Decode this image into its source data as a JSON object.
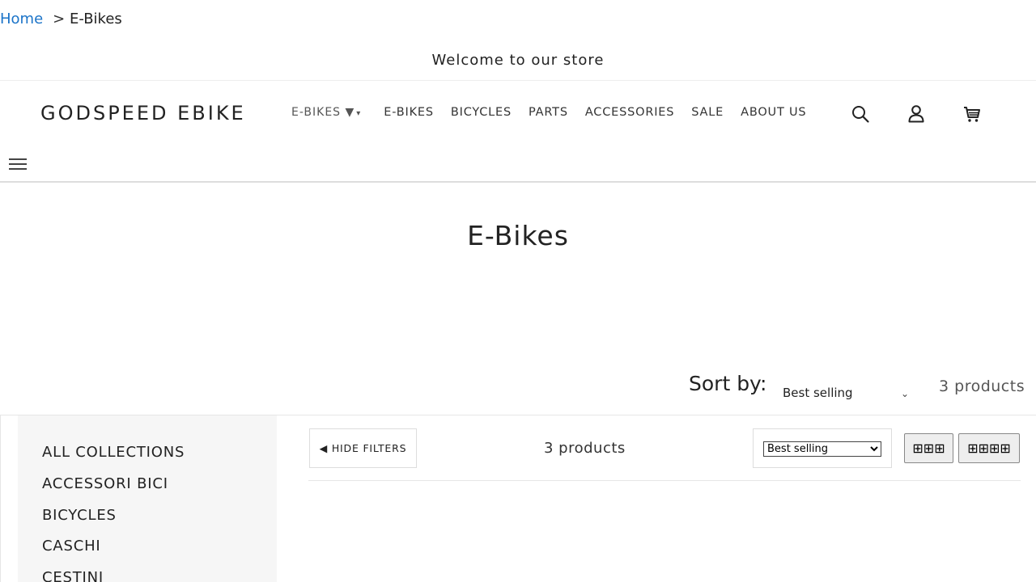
{
  "breadcrumb": {
    "home": "Home",
    "separator": ">",
    "current": "E-Bikes"
  },
  "announcement": "Welcome to our store",
  "header": {
    "logo": "GODSPEED EBIKE",
    "dropdown_label": "E-BIKES ▼",
    "dropdown_caret": "▾",
    "nav": [
      "E-BIKES",
      "BICYCLES",
      "PARTS",
      "ACCESSORIES",
      "SALE",
      "ABOUT US"
    ],
    "icons": [
      "search-icon",
      "account-icon",
      "cart-icon",
      "menu-icon"
    ]
  },
  "collection": {
    "title": "E-Bikes"
  },
  "sort": {
    "label": "Sort by:",
    "value": "Best selling",
    "chevron": "⌄",
    "count": "3 products"
  },
  "sidebar": {
    "items": [
      "ALL COLLECTIONS",
      "ACCESSORI BICI",
      "BICYCLES",
      "CASCHI",
      "CESTINI"
    ]
  },
  "toolbar": {
    "hide_filters": "◀ HIDE FILTERS",
    "count": "3 products",
    "sort_value": "Best selling",
    "grid3": "⊞⊞⊞",
    "grid4": "⊞⊞⊞⊞"
  },
  "colors": {
    "link": "#1a73c8",
    "sidebar_bg": "#f6f6f6",
    "text": "#222222"
  }
}
